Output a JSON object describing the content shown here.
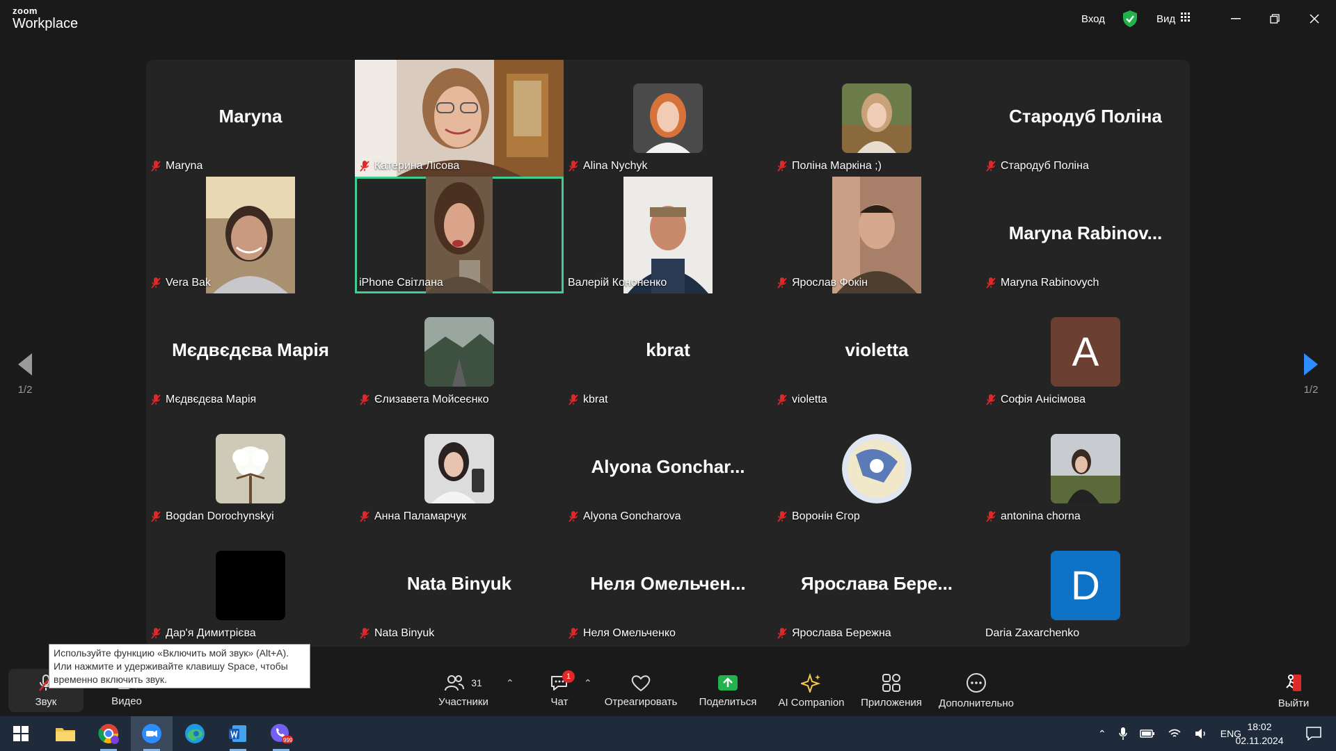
{
  "app": {
    "logo_line1": "zoom",
    "logo_line2": "Workplace",
    "signin_label": "Вход",
    "view_label": "Вид",
    "accent_active": "#3ccf91"
  },
  "pagination": {
    "left_label": "1/2",
    "right_label": "1/2"
  },
  "tiles": [
    {
      "name": "Maryna",
      "display": "Maryna",
      "kind": "name"
    },
    {
      "name": "Катерина Лісова",
      "kind": "video"
    },
    {
      "name": "Alina Nychyk",
      "kind": "avatar"
    },
    {
      "name": "Поліна Маркіна ;)",
      "kind": "avatar"
    },
    {
      "name": "Стародуб Поліна",
      "display": "Стародуб Поліна",
      "kind": "name"
    },
    {
      "name": "Vera Bak",
      "kind": "portrait"
    },
    {
      "name": "iPhone Світлана",
      "kind": "portrait",
      "active": true
    },
    {
      "name": "Валерій Кононенко",
      "kind": "portrait"
    },
    {
      "name": "Ярослав Фокін",
      "kind": "portrait"
    },
    {
      "name": "Maryna Rabinovych",
      "display": "Maryna  Rabinov...",
      "kind": "name"
    },
    {
      "name": "Мєдвєдєва Марія",
      "display": "Мєдвєдєва Марія",
      "kind": "name"
    },
    {
      "name": "Єлизавета Мойсеєнко",
      "kind": "avatar"
    },
    {
      "name": "kbrat",
      "display": "kbrat",
      "kind": "name"
    },
    {
      "name": "violetta",
      "display": "violetta",
      "kind": "name"
    },
    {
      "name": "Софія Анісімова",
      "letter": "A",
      "kind": "letter",
      "color": "#6b4033"
    },
    {
      "name": "Bogdan Dorochynskyi",
      "kind": "avatar"
    },
    {
      "name": "Анна Паламарчук",
      "kind": "avatar"
    },
    {
      "name": "Alyona Goncharova",
      "display": "Alyona  Gonchar...",
      "kind": "name"
    },
    {
      "name": "Воронін Єгор",
      "kind": "avatar"
    },
    {
      "name": "antonina chorna",
      "kind": "avatar"
    },
    {
      "name": "Дар'я Димитрієва",
      "kind": "avatar-black"
    },
    {
      "name": "Nata Binyuk",
      "display": "Nata Binyuk",
      "kind": "name"
    },
    {
      "name": "Неля Омельченко",
      "display": "Неля  Омельчен...",
      "kind": "name"
    },
    {
      "name": "Ярослава Бережна",
      "display": "Ярослава  Бере...",
      "kind": "name"
    },
    {
      "name": "Daria Zaxarchenko",
      "letter": "D",
      "kind": "letter",
      "color": "#0e72c6",
      "muted": false
    }
  ],
  "tooltip": {
    "line1": "Используйте функцию «Включить мой звук» (Alt+A).",
    "line2": "Или нажмите и удерживайте клавишу Space, чтобы",
    "line3": "временно включить звук."
  },
  "controls": {
    "audio": "Звук",
    "video": "Видео",
    "participants": "Участники",
    "participants_count": "31",
    "chat": "Чат",
    "chat_badge": "1",
    "react": "Отреагировать",
    "share": "Поделиться",
    "ai": "AI Companion",
    "apps": "Приложения",
    "more": "Дополнительно",
    "leave": "Выйти",
    "share_color": "#22b14c",
    "leave_color": "#e02828"
  },
  "taskbar": {
    "lang": "ENG",
    "time": "18:02",
    "date": "02.11.2024",
    "viber_badge": "999"
  }
}
